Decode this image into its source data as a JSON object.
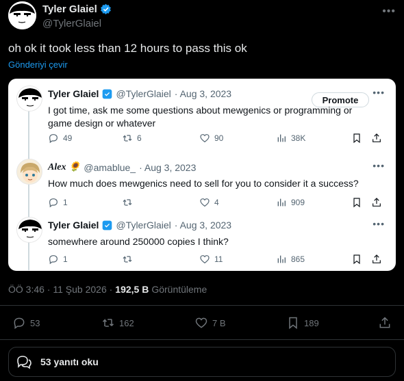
{
  "post": {
    "author_name": "Tyler Glaiel",
    "author_handle": "@TylerGlaiel",
    "text": "oh ok it took less than 12 hours to pass this ok",
    "translate_label": "Gönderiyi çevir",
    "more_icon": "more-horizontal-icon"
  },
  "quote": {
    "tweets": [
      {
        "name": "Tyler Glaiel",
        "handle": "@TylerGlaiel",
        "date": "· Aug 3, 2023",
        "text": "I got time, ask me some questions about mewgenics or programming or game design or whatever",
        "promote_label": "Promote",
        "replies": "49",
        "retweets": "6",
        "likes": "90",
        "views": "38K"
      },
      {
        "name": "Alex 🌻",
        "handle": "@amablue_",
        "date": "· Aug 3, 2023",
        "text": "How much does mewgenics need to sell for you to consider it a success?",
        "replies": "1",
        "retweets": "",
        "likes": "4",
        "views": "909"
      },
      {
        "name": "Tyler Glaiel",
        "handle": "@TylerGlaiel",
        "date": "· Aug 3, 2023",
        "text": "somewhere around 250000 copies I think?",
        "replies": "1",
        "retweets": "",
        "likes": "11",
        "views": "865"
      }
    ]
  },
  "meta": {
    "time": "ÖÖ 3:46 · 11 Şub 2026 ·",
    "views_count": "192,5 B",
    "views_label": "Görüntüleme"
  },
  "stats": {
    "replies": "53",
    "reposts": "162",
    "likes": "7 B",
    "bookmarks": "189"
  },
  "read_replies_label": "53 yanıtı oku",
  "colors": {
    "accent": "#1d9bf0",
    "background": "#000000",
    "muted": "#71767b",
    "card": "#ffffff"
  }
}
